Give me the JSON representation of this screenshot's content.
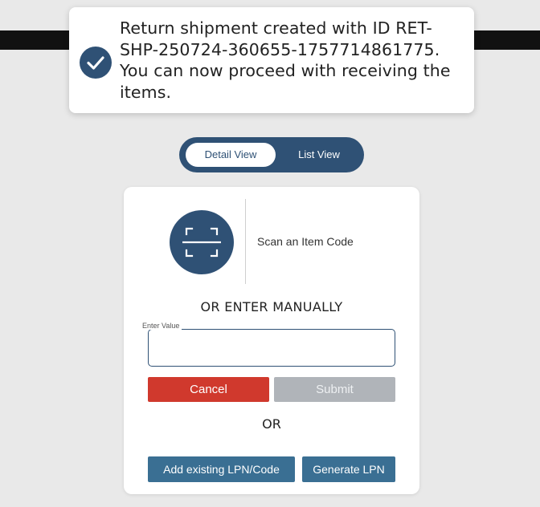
{
  "toast": {
    "icon": "check-circle-icon",
    "message": "Return shipment created with ID RET-SHP-250724-360655-1757714861775. You can now proceed with receiving the items."
  },
  "view_toggle": {
    "options": [
      {
        "label": "Detail View",
        "selected": true
      },
      {
        "label": "List View",
        "selected": false
      }
    ]
  },
  "scan": {
    "icon": "scan-frame-icon",
    "label": "Scan an Item Code"
  },
  "manual_entry": {
    "heading": "OR ENTER MANUALLY",
    "field_label": "Enter Value",
    "field_value": ""
  },
  "actions": {
    "cancel_label": "Cancel",
    "submit_label": "Submit",
    "submit_disabled": true
  },
  "or_separator": "OR",
  "lpn_actions": {
    "add_existing_label": "Add existing LPN/Code",
    "generate_label": "Generate LPN"
  },
  "colors": {
    "primary": "#2f5175",
    "cancel": "#d0392d",
    "disabled": "#b0b4b9",
    "lpn_button": "#3a6f93"
  }
}
